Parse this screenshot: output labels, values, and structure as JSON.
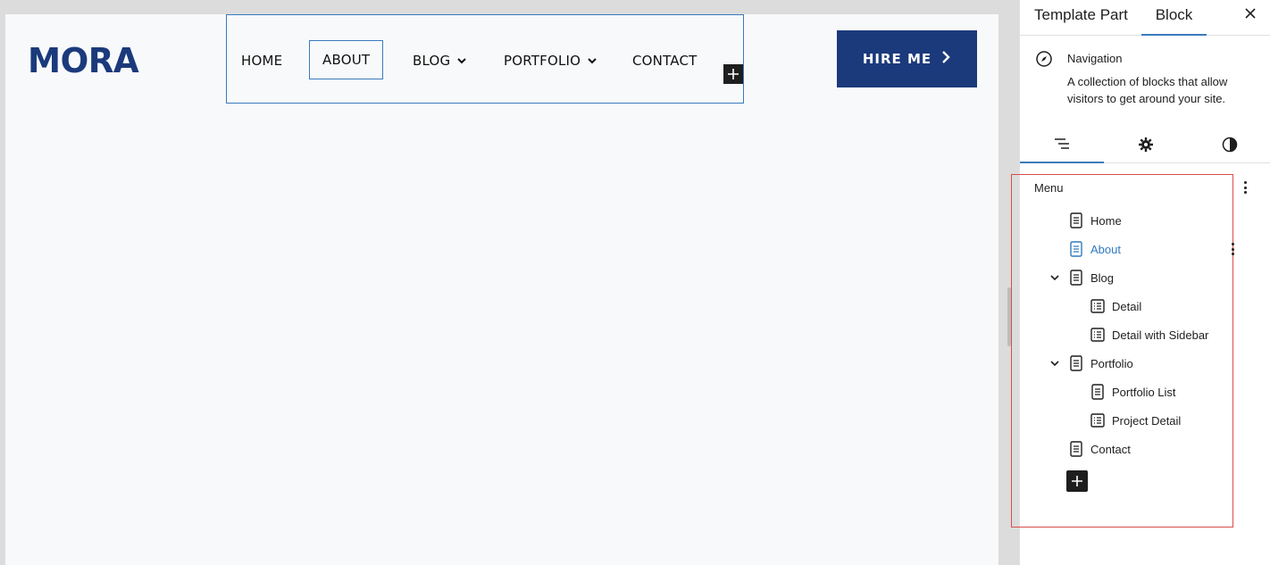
{
  "canvas": {
    "logo": "MORA",
    "nav": [
      {
        "label": "HOME",
        "has_submenu": false
      },
      {
        "label": "ABOUT",
        "has_submenu": false,
        "selected": true
      },
      {
        "label": "BLOG",
        "has_submenu": true
      },
      {
        "label": "PORTFOLIO",
        "has_submenu": true
      },
      {
        "label": "CONTACT",
        "has_submenu": false
      }
    ],
    "hire_button": "HIRE ME"
  },
  "sidebar": {
    "tabs": [
      "Template Part",
      "Block"
    ],
    "active_tab": "Block",
    "block_name": "Navigation",
    "block_description": "A collection of blocks that allow visitors to get around your site.",
    "subtabs": [
      "list-view-icon",
      "settings-icon",
      "styles-icon"
    ],
    "menu_title": "Menu",
    "menu_items": [
      {
        "label": "Home",
        "level": 1,
        "icon": "page-icon"
      },
      {
        "label": "About",
        "level": 1,
        "icon": "page-icon",
        "active": true
      },
      {
        "label": "Blog",
        "level": 1,
        "icon": "page-icon",
        "expanded": true
      },
      {
        "label": "Detail",
        "level": 2,
        "icon": "page-list-icon"
      },
      {
        "label": "Detail with Sidebar",
        "level": 2,
        "icon": "page-list-icon"
      },
      {
        "label": "Portfolio",
        "level": 1,
        "icon": "page-icon",
        "expanded": true
      },
      {
        "label": "Portfolio List",
        "level": 2,
        "icon": "page-icon"
      },
      {
        "label": "Project Detail",
        "level": 2,
        "icon": "page-list-icon"
      },
      {
        "label": "Contact",
        "level": 1,
        "icon": "page-icon"
      }
    ]
  },
  "colors": {
    "brand": "#1b3a7c",
    "accent": "#3a7bbf",
    "highlight": "#d94d4d"
  }
}
